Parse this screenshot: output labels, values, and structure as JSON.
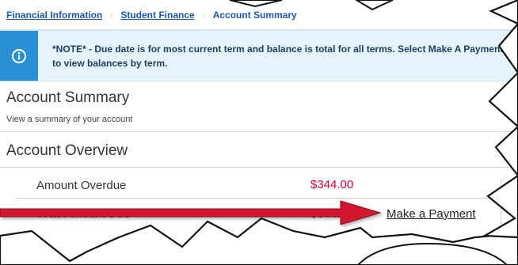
{
  "breadcrumb": {
    "items": [
      {
        "label": "Financial Information"
      },
      {
        "label": "Student Finance"
      },
      {
        "label": "Account Summary"
      }
    ],
    "separator": "›"
  },
  "notice": {
    "line1": "*NOTE* - Due date is for most current term and balance is total for all terms. Select Make A Payment",
    "line2": "to view balances by term.",
    "icon": "info-circle-icon"
  },
  "account_summary": {
    "title": "Account Summary",
    "subtitle": "View a summary of your account"
  },
  "account_overview": {
    "title": "Account Overview",
    "rows": [
      {
        "label": "Amount Overdue",
        "value": "$344.00"
      },
      {
        "label": "Total Amount Due",
        "value": "$344.00"
      }
    ]
  },
  "actions": {
    "make_payment_label": "Make a Payment"
  },
  "colors": {
    "link": "#1a56b8",
    "notice_bg": "#e6f4fd",
    "notice_accent": "#2b8fd6",
    "overdue": "#d8003c",
    "arrow": "#d2122e"
  }
}
